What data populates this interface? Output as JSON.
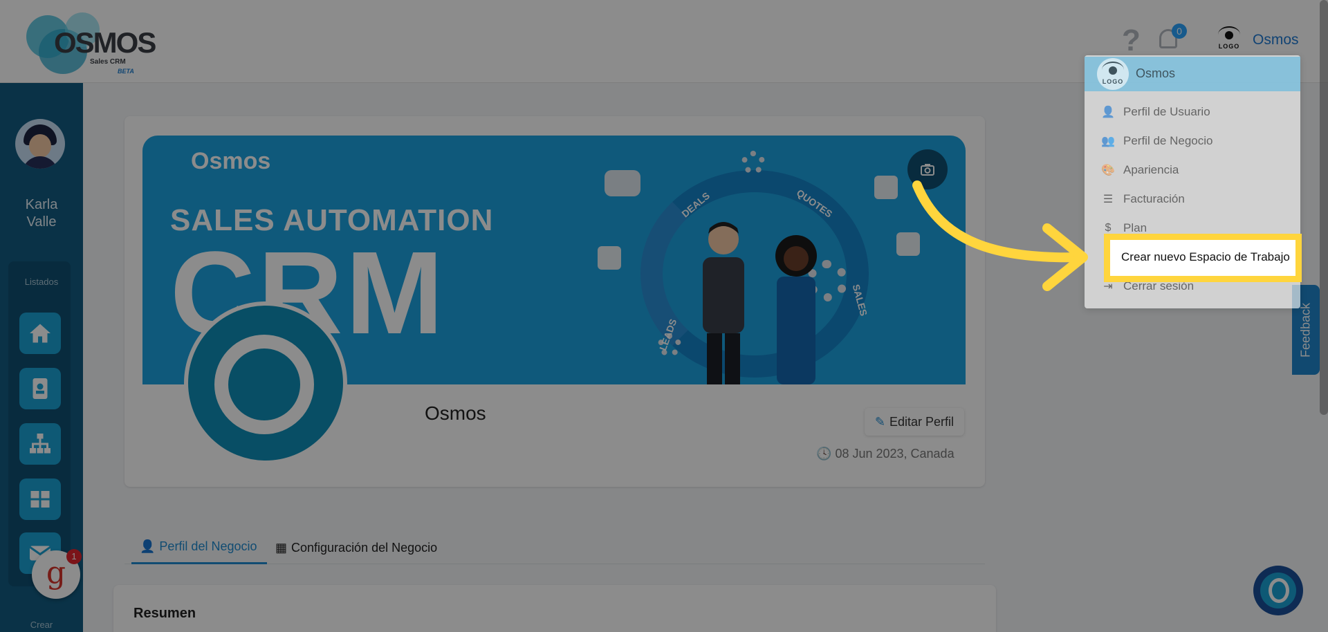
{
  "header": {
    "logo_word": "OSMOS",
    "logo_sub": "Sales CRM",
    "logo_beta": "BETA",
    "help_icon": "?",
    "notification_count": "0",
    "user_name": "Osmos",
    "avatar_text": "LOGO"
  },
  "sidebar": {
    "user_name_line1": "Karla",
    "user_name_line2": "Valle",
    "section_label": "Listados",
    "items": [
      "home-icon",
      "contact-card-icon",
      "org-chart-icon",
      "grid-icon",
      "mail-icon"
    ],
    "footer_label": "Crear",
    "g_badge_letter": "g",
    "g_badge_count": "1"
  },
  "banner": {
    "brand": "Osmos",
    "tagline": "SALES AUTOMATION",
    "big_text": "CRM",
    "labels": [
      "DEALS",
      "QUOTES",
      "SALES",
      "LEADS"
    ]
  },
  "profile": {
    "name": "Osmos",
    "edit_label": "Editar Perfil",
    "date_location": "08 Jun 2023, Canada"
  },
  "tabs": [
    {
      "label": "Perfil del Negocio",
      "active": true
    },
    {
      "label": "Configuración del Negocio",
      "active": false
    }
  ],
  "resumen_title": "Resumen",
  "menu": {
    "header_name": "Osmos",
    "items": [
      {
        "label": "Perfil de Usuario",
        "icon": "user-icon"
      },
      {
        "label": "Perfil de Negocio",
        "icon": "users-icon"
      },
      {
        "label": "Apariencia",
        "icon": "palette-icon"
      },
      {
        "label": "Facturación",
        "icon": "list-icon"
      },
      {
        "label": "Plan",
        "icon": "dollar-icon"
      },
      {
        "label": "Crear nuevo Espacio de Trabajo",
        "icon": "plus-icon"
      },
      {
        "label": "Cerrar sesión",
        "icon": "logout-icon"
      }
    ]
  },
  "feedback_label": "Feedback",
  "colors": {
    "accent": "#1f8ad0",
    "sidebar": "#135c82",
    "highlight": "#ffd53d"
  }
}
